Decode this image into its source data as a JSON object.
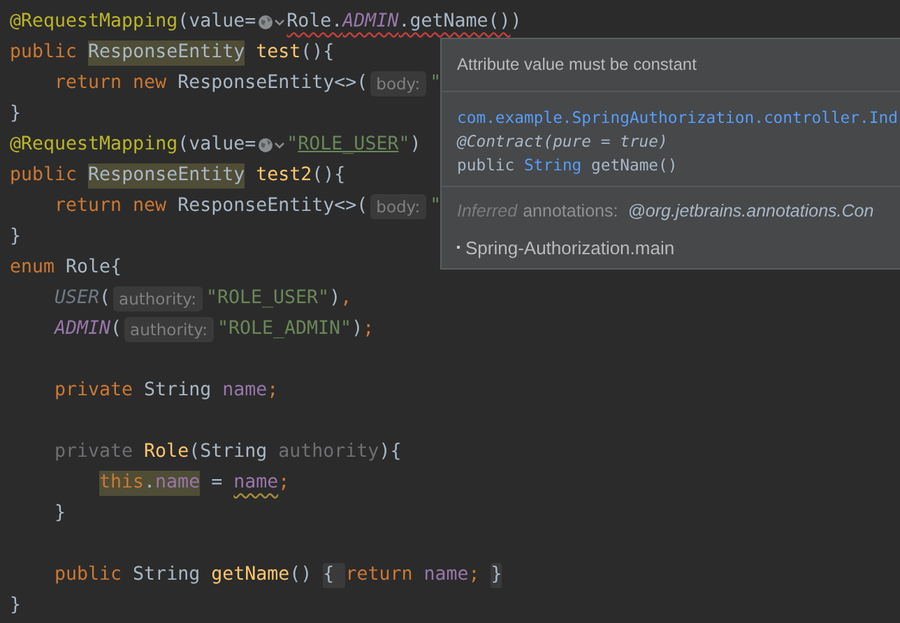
{
  "editor": {
    "lines": [
      {
        "kind": "code",
        "tokens": [
          {
            "kind": "annotation",
            "text": "@RequestMapping"
          },
          {
            "kind": "plain",
            "text": "(value="
          },
          {
            "kind": "icon"
          },
          {
            "kind": "plain",
            "text": "Role.",
            "error": true
          },
          {
            "kind": "constant",
            "text": "ADMIN",
            "error": true
          },
          {
            "kind": "plain",
            "text": ".getName()",
            "error": true
          },
          {
            "kind": "plain",
            "text": ")"
          }
        ]
      },
      {
        "kind": "code",
        "tokens": [
          {
            "kind": "keyword",
            "text": "public "
          },
          {
            "kind": "plain",
            "text": "ResponseEntity",
            "highlighted": true
          },
          {
            "kind": "method",
            "text": " test"
          },
          {
            "kind": "plain",
            "text": "(){"
          }
        ]
      },
      {
        "kind": "code",
        "tokens": [
          {
            "kind": "keyword",
            "text": "    return new "
          },
          {
            "kind": "plain",
            "text": "ResponseEntity<>("
          },
          {
            "kind": "hint",
            "text": "body:"
          },
          {
            "kind": "string",
            "text": "\""
          }
        ]
      },
      {
        "kind": "code",
        "tokens": [
          {
            "kind": "plain",
            "text": "}"
          }
        ]
      },
      {
        "kind": "code",
        "tokens": [
          {
            "kind": "annotation",
            "text": "@RequestMapping"
          },
          {
            "kind": "plain",
            "text": "(value="
          },
          {
            "kind": "icon"
          },
          {
            "kind": "string",
            "text": "\""
          },
          {
            "kind": "string",
            "text": "ROLE_USER",
            "underlined": true
          },
          {
            "kind": "string",
            "text": "\""
          },
          {
            "kind": "plain",
            "text": ")"
          }
        ]
      },
      {
        "kind": "code",
        "tokens": [
          {
            "kind": "keyword",
            "text": "public "
          },
          {
            "kind": "plain",
            "text": "ResponseEntity",
            "highlighted": true
          },
          {
            "kind": "method",
            "text": " test2"
          },
          {
            "kind": "plain",
            "text": "(){"
          }
        ]
      },
      {
        "kind": "code",
        "tokens": [
          {
            "kind": "keyword",
            "text": "    return new "
          },
          {
            "kind": "plain",
            "text": "ResponseEntity<>("
          },
          {
            "kind": "hint",
            "text": "body:"
          },
          {
            "kind": "string",
            "text": "\""
          }
        ]
      },
      {
        "kind": "code",
        "tokens": [
          {
            "kind": "plain",
            "text": "}"
          }
        ]
      },
      {
        "kind": "code",
        "tokens": [
          {
            "kind": "keyword",
            "text": "enum "
          },
          {
            "kind": "plain",
            "text": "Role{"
          }
        ]
      },
      {
        "kind": "code",
        "tokens": [
          {
            "kind": "constant-dim",
            "text": "    USER"
          },
          {
            "kind": "plain",
            "text": "("
          },
          {
            "kind": "hint",
            "text": "authority:"
          },
          {
            "kind": "string",
            "text": "\"ROLE_USER\""
          },
          {
            "kind": "plain",
            "text": ")"
          },
          {
            "kind": "keyword",
            "text": ","
          }
        ]
      },
      {
        "kind": "code",
        "tokens": [
          {
            "kind": "constant",
            "text": "    ADMIN"
          },
          {
            "kind": "plain",
            "text": "("
          },
          {
            "kind": "hint",
            "text": "authority:"
          },
          {
            "kind": "string",
            "text": "\"ROLE_ADMIN\""
          },
          {
            "kind": "plain",
            "text": ")"
          },
          {
            "kind": "keyword",
            "text": ";"
          }
        ]
      },
      {
        "kind": "blank"
      },
      {
        "kind": "code",
        "tokens": [
          {
            "kind": "keyword",
            "text": "    private "
          },
          {
            "kind": "plain",
            "text": "String "
          },
          {
            "kind": "field",
            "text": "name"
          },
          {
            "kind": "keyword",
            "text": ";"
          }
        ]
      },
      {
        "kind": "blank"
      },
      {
        "kind": "code",
        "tokens": [
          {
            "kind": "unused",
            "text": "    private "
          },
          {
            "kind": "method",
            "text": "Role"
          },
          {
            "kind": "plain",
            "text": "(String "
          },
          {
            "kind": "unused",
            "text": "authority"
          },
          {
            "kind": "plain",
            "text": "){"
          }
        ]
      },
      {
        "kind": "code",
        "tokens": [
          {
            "kind": "keyword",
            "text": "        this",
            "highlighted": true
          },
          {
            "kind": "plain",
            "text": ".",
            "highlighted": true
          },
          {
            "kind": "field",
            "text": "name",
            "highlighted": true
          },
          {
            "kind": "plain",
            "text": " = "
          },
          {
            "kind": "field",
            "text": "name",
            "warning": true
          },
          {
            "kind": "keyword",
            "text": ";"
          }
        ]
      },
      {
        "kind": "code",
        "tokens": [
          {
            "kind": "plain",
            "text": "    }"
          }
        ]
      },
      {
        "kind": "blank"
      },
      {
        "kind": "code",
        "tokens": [
          {
            "kind": "keyword",
            "text": "    public "
          },
          {
            "kind": "plain",
            "text": "String "
          },
          {
            "kind": "method",
            "text": "getName"
          },
          {
            "kind": "plain",
            "text": "() "
          },
          {
            "kind": "fold",
            "text": "{ "
          },
          {
            "kind": "keyword",
            "text": "return "
          },
          {
            "kind": "field",
            "text": "name"
          },
          {
            "kind": "keyword",
            "text": "; "
          },
          {
            "kind": "fold",
            "text": "}"
          }
        ]
      },
      {
        "kind": "code",
        "tokens": [
          {
            "kind": "plain",
            "text": "}"
          }
        ]
      }
    ]
  },
  "popup": {
    "message": "Attribute value must be constant",
    "signature": [
      {
        "kind": "link",
        "text": "com.example.SpringAuthorization.controller.Ind"
      },
      {
        "kind": "annotation",
        "text": "@Contract(pure = true)"
      },
      {
        "kind": "declaration",
        "text": "public **String** getName()"
      }
    ],
    "inferred": {
      "label": "Inferred",
      "text": "annotations:",
      "value": "@org.jetbrains.annotations.Con"
    },
    "module": "Spring-Authorization.main"
  }
}
